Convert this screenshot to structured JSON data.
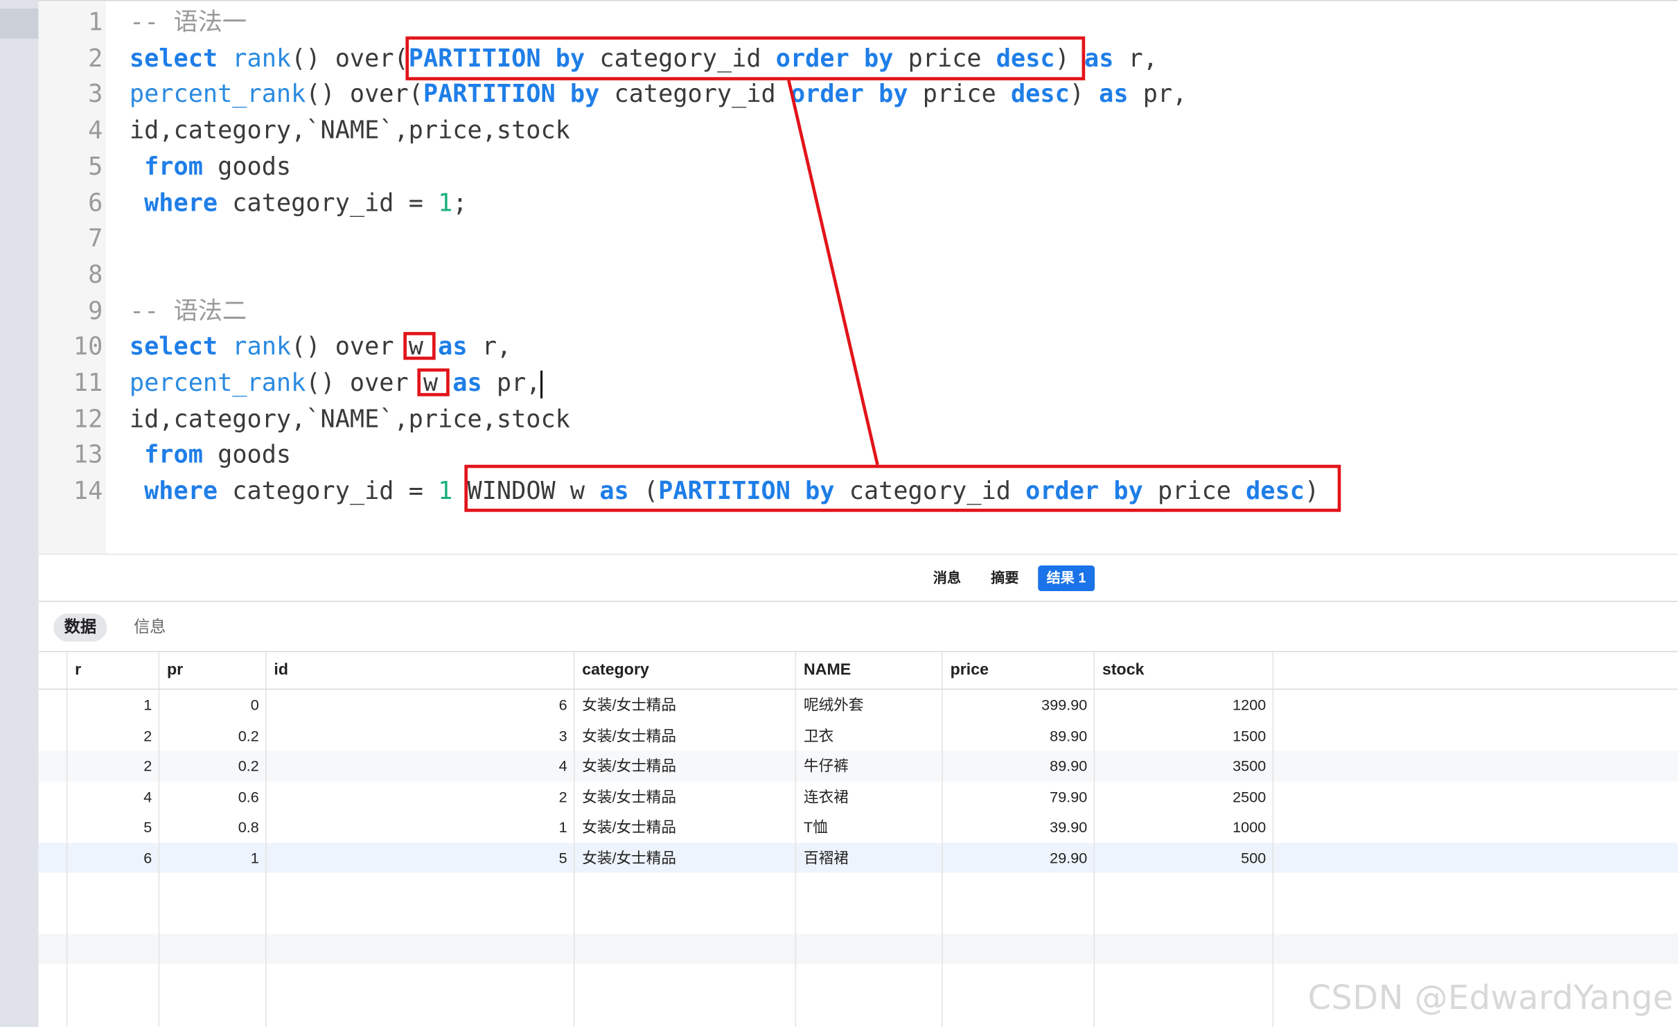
{
  "editor": {
    "lines": [
      {
        "num": "1",
        "tokens": [
          {
            "t": "-- 语法一",
            "c": "cm"
          }
        ]
      },
      {
        "num": "2",
        "tokens": [
          {
            "t": "select",
            "c": "kw"
          },
          {
            "t": " "
          },
          {
            "t": "rank",
            "c": "fn"
          },
          {
            "t": "() over("
          },
          {
            "t": "PARTITION",
            "c": "kw"
          },
          {
            "t": " "
          },
          {
            "t": "by",
            "c": "kw"
          },
          {
            "t": " category_id "
          },
          {
            "t": "order",
            "c": "kw"
          },
          {
            "t": " "
          },
          {
            "t": "by",
            "c": "kw"
          },
          {
            "t": " price "
          },
          {
            "t": "desc",
            "c": "kw"
          },
          {
            "t": ") "
          },
          {
            "t": "as",
            "c": "kw"
          },
          {
            "t": " r,"
          }
        ]
      },
      {
        "num": "3",
        "tokens": [
          {
            "t": "percent_rank",
            "c": "fn"
          },
          {
            "t": "() over("
          },
          {
            "t": "PARTITION",
            "c": "kw"
          },
          {
            "t": " "
          },
          {
            "t": "by",
            "c": "kw"
          },
          {
            "t": " category_id "
          },
          {
            "t": "order",
            "c": "kw"
          },
          {
            "t": " "
          },
          {
            "t": "by",
            "c": "kw"
          },
          {
            "t": " price "
          },
          {
            "t": "desc",
            "c": "kw"
          },
          {
            "t": ") "
          },
          {
            "t": "as",
            "c": "kw"
          },
          {
            "t": " pr,"
          }
        ]
      },
      {
        "num": "4",
        "tokens": [
          {
            "t": "id,category,`NAME`,price,stock"
          }
        ]
      },
      {
        "num": "5",
        "tokens": [
          {
            "t": " "
          },
          {
            "t": "from",
            "c": "kw"
          },
          {
            "t": " goods"
          }
        ]
      },
      {
        "num": "6",
        "tokens": [
          {
            "t": " "
          },
          {
            "t": "where",
            "c": "kw"
          },
          {
            "t": " category_id = "
          },
          {
            "t": "1",
            "c": "num"
          },
          {
            "t": ";"
          }
        ]
      },
      {
        "num": "7",
        "tokens": []
      },
      {
        "num": "8",
        "tokens": []
      },
      {
        "num": "9",
        "tokens": [
          {
            "t": "-- 语法二",
            "c": "cm"
          }
        ]
      },
      {
        "num": "10",
        "tokens": [
          {
            "t": "select",
            "c": "kw"
          },
          {
            "t": " "
          },
          {
            "t": "rank",
            "c": "fn"
          },
          {
            "t": "() over w "
          },
          {
            "t": "as",
            "c": "kw"
          },
          {
            "t": " r,"
          }
        ]
      },
      {
        "num": "11",
        "tokens": [
          {
            "t": "percent_rank",
            "c": "fn"
          },
          {
            "t": "() over w "
          },
          {
            "t": "as",
            "c": "kw"
          },
          {
            "t": " pr,"
          },
          {
            "t": "",
            "c": "cursor"
          }
        ]
      },
      {
        "num": "12",
        "tokens": [
          {
            "t": "id,category,`NAME`,price,stock"
          }
        ]
      },
      {
        "num": "13",
        "tokens": [
          {
            "t": " "
          },
          {
            "t": "from",
            "c": "kw"
          },
          {
            "t": " goods"
          }
        ]
      },
      {
        "num": "14",
        "tokens": [
          {
            "t": " "
          },
          {
            "t": "where",
            "c": "kw"
          },
          {
            "t": " category_id = "
          },
          {
            "t": "1",
            "c": "num"
          },
          {
            "t": " WINDOW w "
          },
          {
            "t": "as",
            "c": "kw"
          },
          {
            "t": " ("
          },
          {
            "t": "PARTITION",
            "c": "kw"
          },
          {
            "t": " "
          },
          {
            "t": "by",
            "c": "kw"
          },
          {
            "t": " category_id "
          },
          {
            "t": "order",
            "c": "kw"
          },
          {
            "t": " "
          },
          {
            "t": "by",
            "c": "kw"
          },
          {
            "t": " price "
          },
          {
            "t": "desc",
            "c": "kw"
          },
          {
            "t": ")"
          }
        ]
      }
    ]
  },
  "result_tabs": {
    "messages": "消息",
    "summary": "摘要",
    "result1": "结果 1"
  },
  "sub_tabs": {
    "data": "数据",
    "info": "信息"
  },
  "grid": {
    "columns": [
      "r",
      "pr",
      "id",
      "category",
      "NAME",
      "price",
      "stock"
    ],
    "rows": [
      [
        "1",
        "0",
        "6",
        "女装/女士精品",
        "呢绒外套",
        "399.90",
        "1200"
      ],
      [
        "2",
        "0.2",
        "3",
        "女装/女士精品",
        "卫衣",
        "89.90",
        "1500"
      ],
      [
        "2",
        "0.2",
        "4",
        "女装/女士精品",
        "牛仔裤",
        "89.90",
        "3500"
      ],
      [
        "4",
        "0.6",
        "2",
        "女装/女士精品",
        "连衣裙",
        "79.90",
        "2500"
      ],
      [
        "5",
        "0.8",
        "1",
        "女装/女士精品",
        "T恤",
        "39.90",
        "1000"
      ],
      [
        "6",
        "1",
        "5",
        "女装/女士精品",
        "百褶裙",
        "29.90",
        "500"
      ]
    ]
  },
  "watermark": "CSDN @EdwardYange",
  "colors": {
    "keyword": "#1f7ee8",
    "number": "#19b07c",
    "annotation": "#e2141a",
    "active_tab": "#1a73e8"
  }
}
